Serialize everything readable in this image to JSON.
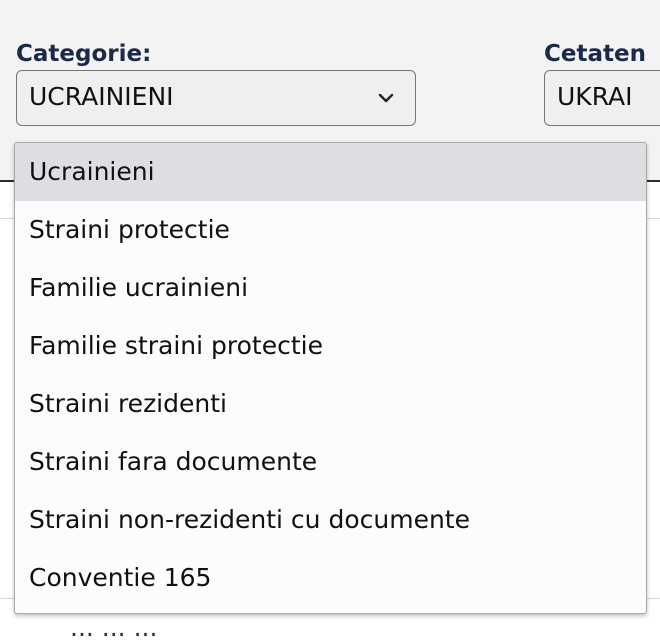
{
  "form": {
    "categorie_label": "Categorie:",
    "categorie_value": "UCRAINIENI",
    "cetatenie_label": "Cetaten",
    "cetatenie_value": "UKRAI"
  },
  "dropdown": {
    "options": [
      {
        "label": "Ucrainieni",
        "selected": true
      },
      {
        "label": "Straini protectie",
        "selected": false
      },
      {
        "label": "Familie ucrainieni",
        "selected": false
      },
      {
        "label": "Familie straini protectie",
        "selected": false
      },
      {
        "label": "Straini rezidenti",
        "selected": false
      },
      {
        "label": "Straini fara documente",
        "selected": false
      },
      {
        "label": "Straini non-rezidenti cu documente",
        "selected": false
      },
      {
        "label": "Conventie 165",
        "selected": false
      }
    ]
  },
  "behind": {
    "partial_text": "... ... ..."
  },
  "icons": {
    "select_arrow": "chevron-down-icon"
  },
  "colors": {
    "label": "#1a2a4a",
    "selected_option_bg": "#dedee2",
    "dropdown_bg": "#fcfcff",
    "select_bg": "#efefef"
  }
}
